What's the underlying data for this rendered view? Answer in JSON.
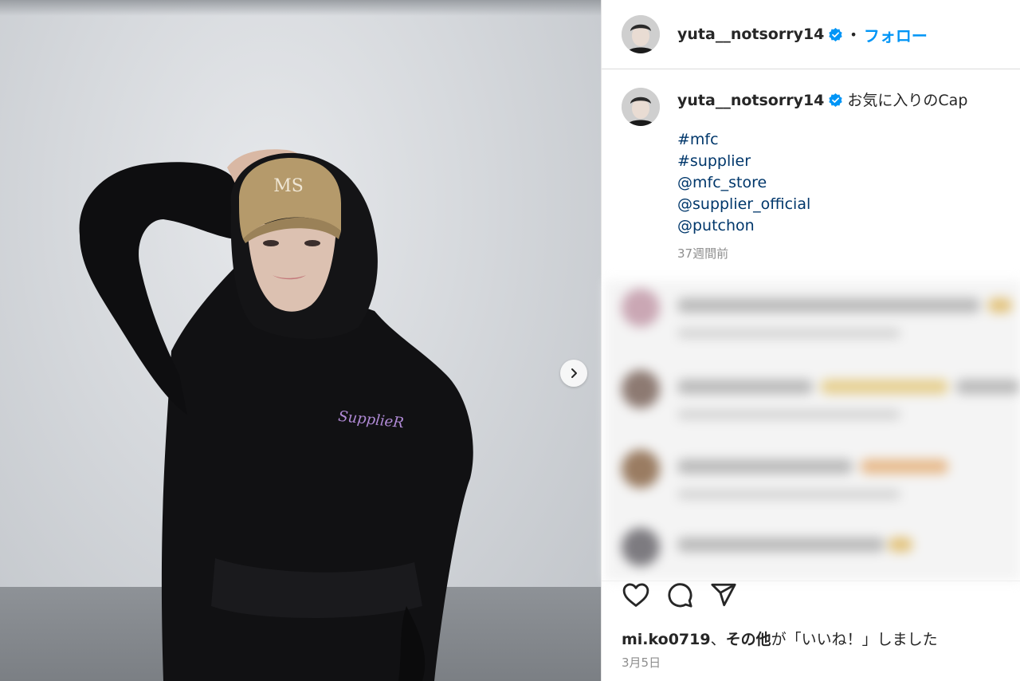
{
  "post": {
    "username": "yuta__notsorry14",
    "dot": "•",
    "follow_label": "フォロー",
    "caption_text": "お気に入りのCap",
    "hashtags": [
      "#mfc",
      "#supplier",
      "@mfc_store",
      "@supplier_official",
      "@putchon"
    ],
    "time_ago": "37週間前",
    "likes_user": "mi.ko0719",
    "likes_sep": "、",
    "likes_others": "その他",
    "likes_suffix": "が「いいね！」しました",
    "post_date": "3月5日"
  },
  "photo": {
    "hoodie_print": "SupplieR",
    "cap_logo": "MS"
  },
  "icons": {
    "verified": "verified-badge-icon",
    "like": "heart-icon",
    "comment": "comment-icon",
    "share": "paper-plane-icon",
    "next": "chevron-right-icon"
  },
  "colors": {
    "link": "#00376b",
    "follow": "#0095f6",
    "verified": "#0095f6",
    "muted": "#8e8e8e"
  }
}
